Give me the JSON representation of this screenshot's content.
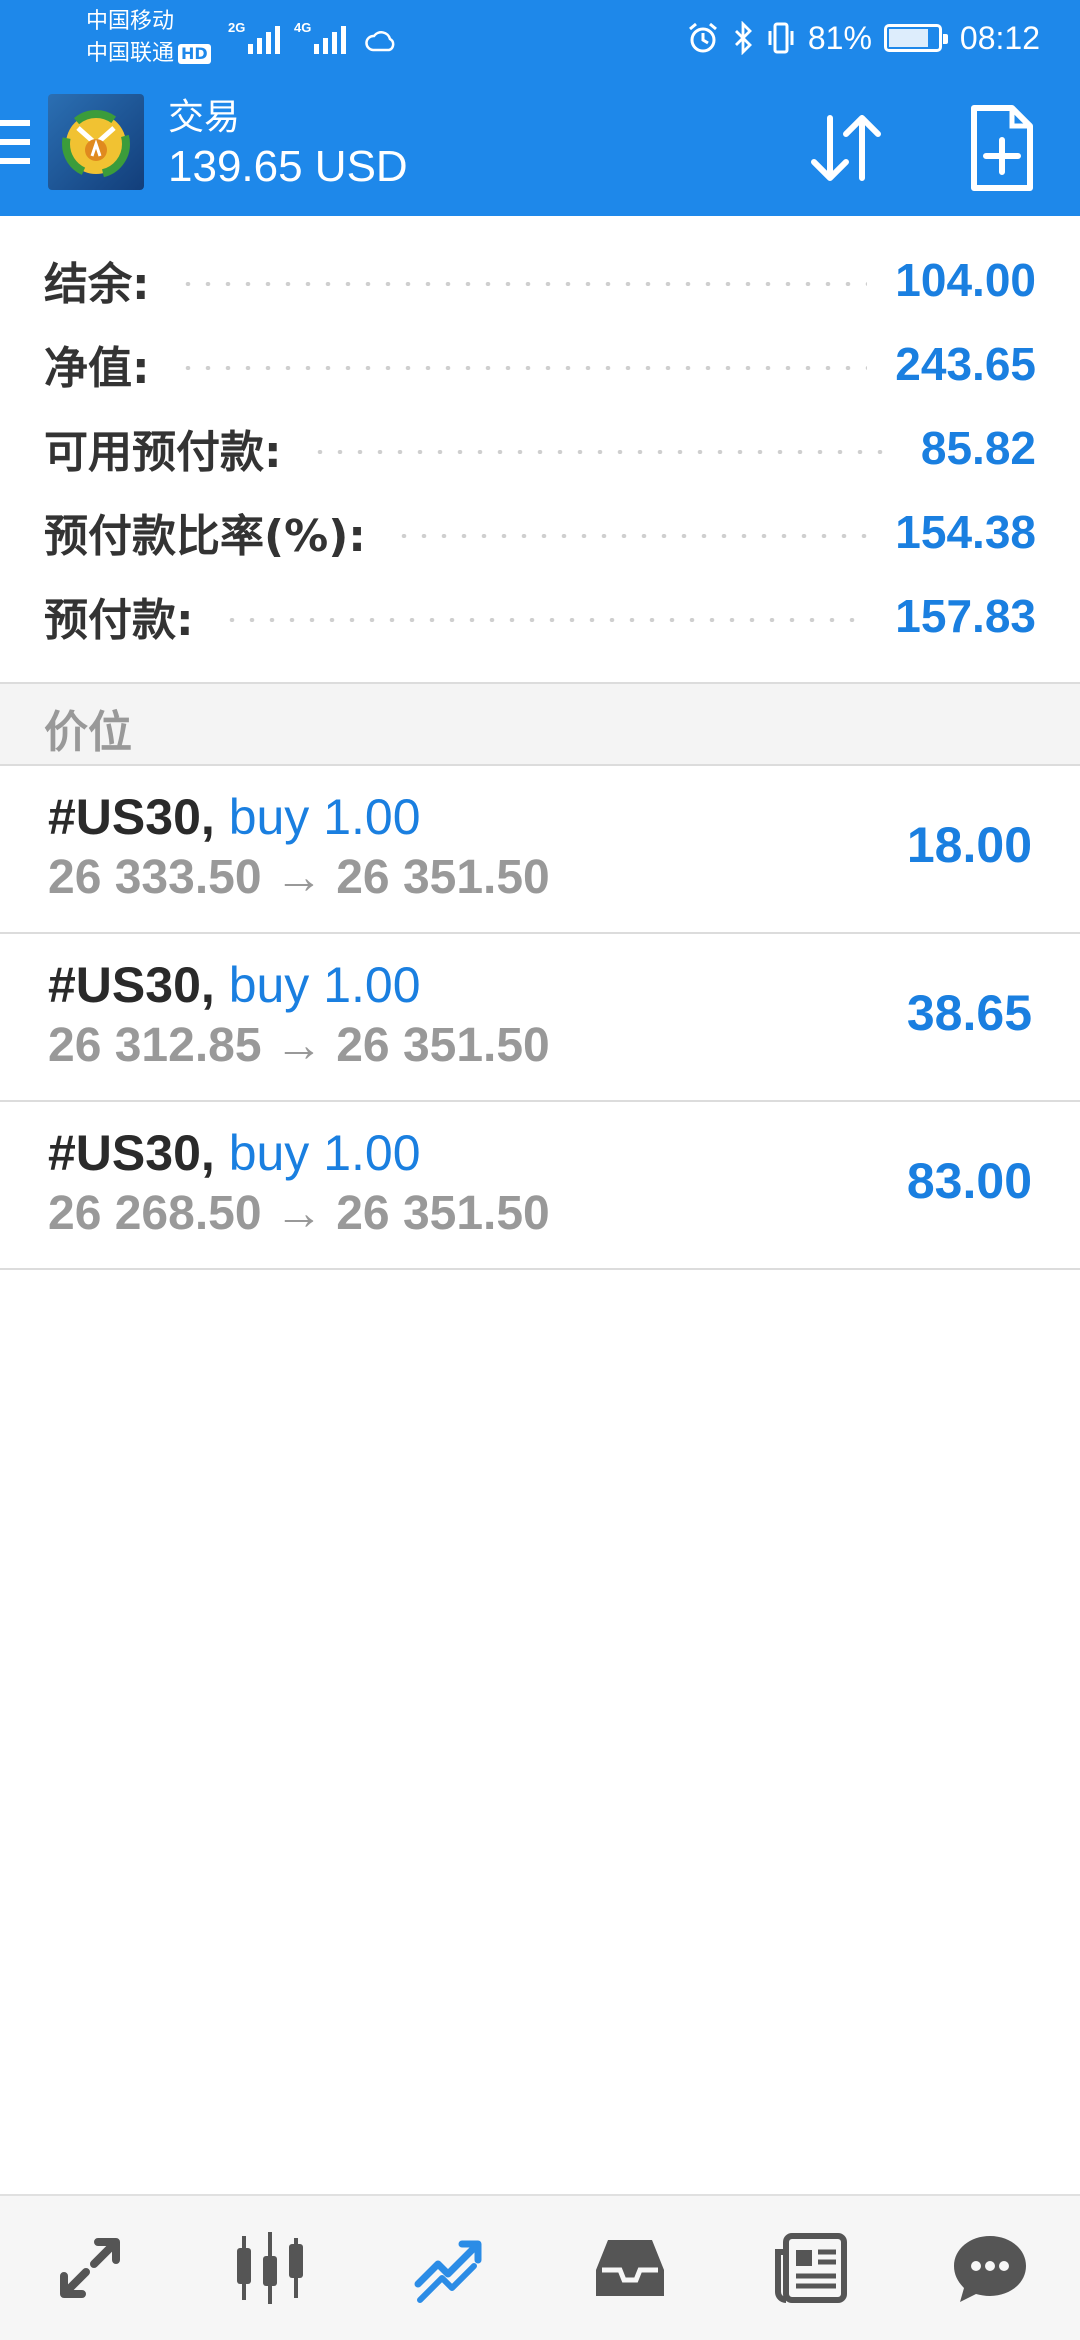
{
  "status_bar": {
    "carrier_1": "中国移动",
    "carrier_2": "中国联通",
    "hd_badge": "HD",
    "signal_1_tag": "2G",
    "signal_2_tag": "4G",
    "battery_percent": "81%",
    "battery_level": 0.81,
    "time": "08:12"
  },
  "header": {
    "title": "交易",
    "subtitle": "139.65 USD",
    "accent_color": "#1e88ea"
  },
  "summary": [
    {
      "label": "结余:",
      "value": "104.00"
    },
    {
      "label": "净值:",
      "value": "243.65"
    },
    {
      "label": "可用预付款:",
      "value": "85.82"
    },
    {
      "label": "预付款比率(%):",
      "value": "154.38"
    },
    {
      "label": "预付款:",
      "value": "157.83"
    }
  ],
  "section": {
    "title": "价位"
  },
  "positions": [
    {
      "symbol": "#US30,",
      "side": "buy 1.00",
      "prices": "26 333.50 → 26 351.50",
      "profit": "18.00"
    },
    {
      "symbol": "#US30,",
      "side": "buy 1.00",
      "prices": "26 312.85 → 26 351.50",
      "profit": "38.65"
    },
    {
      "symbol": "#US30,",
      "side": "buy 1.00",
      "prices": "26 268.50 → 26 351.50",
      "profit": "83.00"
    }
  ],
  "bottom_nav": [
    {
      "icon": "quotes-icon",
      "active": false
    },
    {
      "icon": "chart-icon",
      "active": false
    },
    {
      "icon": "trade-icon",
      "active": true
    },
    {
      "icon": "history-icon",
      "active": false
    },
    {
      "icon": "news-icon",
      "active": false
    },
    {
      "icon": "chat-icon",
      "active": false
    }
  ]
}
